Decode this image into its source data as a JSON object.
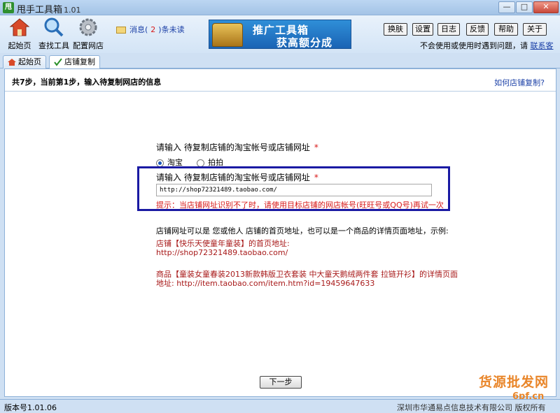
{
  "window": {
    "title": "甩手工具箱",
    "version": "1.01",
    "icon_text": "甩",
    "controls": [
      "—",
      "□",
      "✕"
    ]
  },
  "toolbar": {
    "tools": [
      {
        "label": "起始页",
        "icon": "home-icon"
      },
      {
        "label": "查找工具",
        "icon": "magnifier-icon"
      },
      {
        "label": "配置网店",
        "icon": "gear-icon"
      }
    ],
    "message": {
      "prefix": "消息(",
      "count": "2",
      "suffix": ")条未读"
    },
    "banner": {
      "line1": "推广工具箱",
      "line2": "获高额分成"
    },
    "buttons": [
      "换肤",
      "设置",
      "日志",
      "反馈",
      "帮助",
      "关于"
    ],
    "help_text": "不会使用或使用时遇到问题，请",
    "help_link": "联系客服"
  },
  "tabs": [
    {
      "label": "起始页",
      "icon": "home-icon",
      "active": false
    },
    {
      "label": "店铺复制",
      "icon": "check-icon",
      "active": true
    }
  ],
  "content": {
    "step_text": "共7步，当前第1步，输入待复制网店的信息",
    "how_link": "如何店铺复制?",
    "input_label": "请输入 待复制店铺的淘宝帐号或店铺网址",
    "required_mark": "*",
    "radios": [
      {
        "label": "淘宝",
        "selected": true
      },
      {
        "label": "拍拍",
        "selected": false
      }
    ],
    "input_label2": "请输入 待复制店铺的淘宝帐号或店铺网址",
    "url_value": "http://shop72321489.taobao.com/",
    "tip": "提示：当店铺网址识别不了时，请使用目标店铺的网店帐号(旺旺号或QQ号)再试一次",
    "example_desc": "店铺网址可以是 您或他人 店铺的首页地址，也可以是一个商品的详情页面地址，示例:",
    "example1_line1": "店铺【快乐天使童年童装】的首页地址:",
    "example1_line2": "http://shop72321489.taobao.com/",
    "example2_line1": "商品【童装女童春装2013新款韩版卫衣套装 中大童天鹅绒两件套 拉链开衫】的详情页面",
    "example2_line2": "地址: http://item.taobao.com/item.htm?id=19459647633",
    "next_button": "下一步"
  },
  "status": {
    "version": "版本号1.01.06",
    "company": "深圳市华通易点信息技术有限公司 版权所有"
  },
  "watermark": {
    "text": "货源批发网",
    "sub": "6pf.cn"
  }
}
